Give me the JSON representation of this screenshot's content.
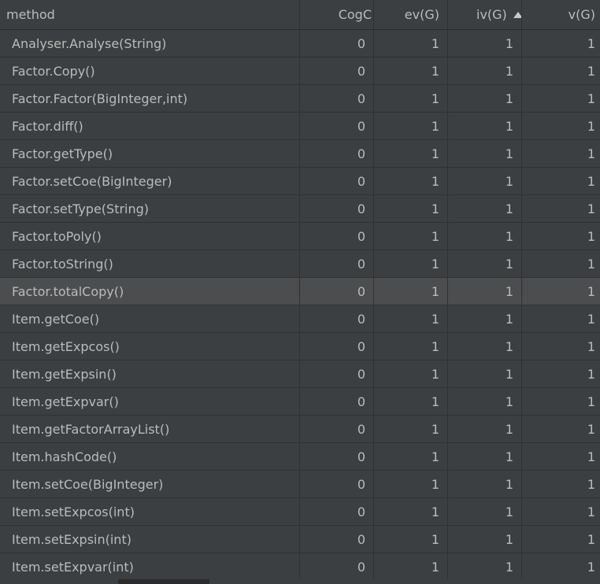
{
  "columns": {
    "method": "method",
    "cogc": "CogC",
    "ev": "ev(G)",
    "iv": "iv(G)",
    "v": "v(G)",
    "sort_icon": "sort-ascending-icon"
  },
  "rows": [
    {
      "method": "Analyser.Analyse(String)",
      "cogc": "0",
      "ev": "1",
      "iv": "1",
      "v": "1"
    },
    {
      "method": "Factor.Copy()",
      "cogc": "0",
      "ev": "1",
      "iv": "1",
      "v": "1"
    },
    {
      "method": "Factor.Factor(BigInteger,int)",
      "cogc": "0",
      "ev": "1",
      "iv": "1",
      "v": "1"
    },
    {
      "method": "Factor.diff()",
      "cogc": "0",
      "ev": "1",
      "iv": "1",
      "v": "1"
    },
    {
      "method": "Factor.getType()",
      "cogc": "0",
      "ev": "1",
      "iv": "1",
      "v": "1"
    },
    {
      "method": "Factor.setCoe(BigInteger)",
      "cogc": "0",
      "ev": "1",
      "iv": "1",
      "v": "1"
    },
    {
      "method": "Factor.setType(String)",
      "cogc": "0",
      "ev": "1",
      "iv": "1",
      "v": "1"
    },
    {
      "method": "Factor.toPoly()",
      "cogc": "0",
      "ev": "1",
      "iv": "1",
      "v": "1"
    },
    {
      "method": "Factor.toString()",
      "cogc": "0",
      "ev": "1",
      "iv": "1",
      "v": "1"
    },
    {
      "method": "Factor.totalCopy()",
      "cogc": "0",
      "ev": "1",
      "iv": "1",
      "v": "1"
    },
    {
      "method": "Item.getCoe()",
      "cogc": "0",
      "ev": "1",
      "iv": "1",
      "v": "1"
    },
    {
      "method": "Item.getExpcos()",
      "cogc": "0",
      "ev": "1",
      "iv": "1",
      "v": "1"
    },
    {
      "method": "Item.getExpsin()",
      "cogc": "0",
      "ev": "1",
      "iv": "1",
      "v": "1"
    },
    {
      "method": "Item.getExpvar()",
      "cogc": "0",
      "ev": "1",
      "iv": "1",
      "v": "1"
    },
    {
      "method": "Item.getFactorArrayList()",
      "cogc": "0",
      "ev": "1",
      "iv": "1",
      "v": "1"
    },
    {
      "method": "Item.hashCode()",
      "cogc": "0",
      "ev": "1",
      "iv": "1",
      "v": "1"
    },
    {
      "method": "Item.setCoe(BigInteger)",
      "cogc": "0",
      "ev": "1",
      "iv": "1",
      "v": "1"
    },
    {
      "method": "Item.setExpcos(int)",
      "cogc": "0",
      "ev": "1",
      "iv": "1",
      "v": "1"
    },
    {
      "method": "Item.setExpsin(int)",
      "cogc": "0",
      "ev": "1",
      "iv": "1",
      "v": "1"
    },
    {
      "method": "Item.setExpvar(int)",
      "cogc": "0",
      "ev": "1",
      "iv": "1",
      "v": "1"
    }
  ],
  "selected_row": 9,
  "colors": {
    "background": "#3c3f41",
    "selected_row": "#4b4d4f",
    "text": "#bbbbbb"
  }
}
